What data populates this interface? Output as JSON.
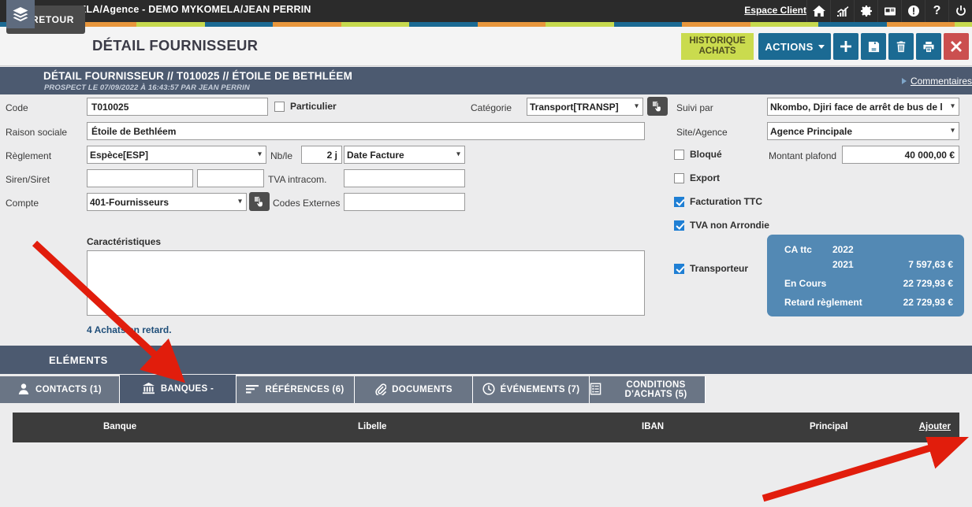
{
  "topbar": {
    "title": "DEMO MYKOMELA/Agence - DEMO MYKOMELA/JEAN PERRIN",
    "espace_client": "Espace Client",
    "icons": [
      "home-icon",
      "chart-icon",
      "gear-icon",
      "card-icon",
      "alert-icon",
      "help-icon",
      "power-icon"
    ]
  },
  "stripe_colors": [
    "#1b6a93",
    "#e8963c",
    "#c6d94e"
  ],
  "action_header": {
    "back_label": "RETOUR",
    "page_title": "DÉTAIL FOURNISSEUR",
    "historique_line1": "HISTORIQUE",
    "historique_line2": "ACHATS",
    "actions_label": "ACTIONS",
    "add_label": "add-icon",
    "save_label": "save-icon",
    "delete_label": "trash-icon",
    "print_label": "print-icon",
    "close_label": "close-icon"
  },
  "record_header": {
    "title": "DÉTAIL FOURNISSEUR // T010025 // ÉTOILE DE BETHLÉEM",
    "subtitle": "PROSPECT LE 07/09/2022 À 16:43:57 PAR JEAN PERRIN",
    "comments_link": "Commentaires"
  },
  "form": {
    "code_label": "Code",
    "code_value": "T010025",
    "particulier_label": "Particulier",
    "particulier_checked": false,
    "categorie_label": "Catégorie",
    "categorie_value": "Transport[TRANSP]",
    "suivi_par_label": "Suivi par",
    "suivi_par_value": "Nkombo, Djiri face de arrêt de bus de l",
    "raison_sociale_label": "Raison sociale",
    "raison_sociale_value": "Étoile de Bethléem",
    "site_agence_label": "Site/Agence",
    "site_agence_value": "Agence Principale",
    "reglement_label": "Règlement",
    "reglement_value": "Espèce[ESP]",
    "nble_label": "Nb/le",
    "nble_value": "2 j",
    "date_facture_value": "Date Facture",
    "bloque_label": "Bloqué",
    "bloque_checked": false,
    "montant_plafond_label": "Montant plafond",
    "montant_plafond_value": "40 000,00 €",
    "siren_siret_label": "Siren/Siret",
    "siren_value": "",
    "siret_value": "",
    "tva_intracom_label": "TVA intracom.",
    "tva_intracom_value": "",
    "export_label": "Export",
    "export_checked": false,
    "compte_label": "Compte",
    "compte_value": "401-Fournisseurs",
    "codes_externes_label": "Codes Externes",
    "codes_externes_value": "",
    "facturation_ttc_label": "Facturation TTC",
    "facturation_ttc_checked": true,
    "tva_non_arrondie_label": "TVA non Arrondie",
    "tva_non_arrondie_checked": true,
    "transporteur_label": "Transporteur",
    "transporteur_checked": true,
    "caracteristiques_label": "Caractéristiques",
    "caracteristiques_value": "",
    "achats_retard": "4 Achats en retard."
  },
  "stats": {
    "ca_ttc_label": "CA ttc",
    "year_current": "2022",
    "year_current_value": "",
    "year_prev": "2021",
    "year_prev_value": "7 597,63 €",
    "en_cours_label": "En Cours",
    "en_cours_value": "22 729,93 €",
    "retard_label": "Retard règlement",
    "retard_value": "22 729,93 €",
    "bg_color": "#5389b4"
  },
  "elements": {
    "label": "ELÉMENTS",
    "tabs": [
      {
        "label": "CONTACTS (1)",
        "icon": "person-icon",
        "active": false,
        "two_line": false
      },
      {
        "label": "BANQUES -",
        "icon": "bank-icon",
        "active": true,
        "two_line": false
      },
      {
        "label": "RÉFÉRENCES (6)",
        "icon": "list-icon",
        "active": false,
        "two_line": false
      },
      {
        "label": "DOCUMENTS",
        "icon": "paperclip-icon",
        "active": false,
        "two_line": false
      },
      {
        "label": "ÉVÉNEMENTS (7)",
        "icon": "clock-icon",
        "active": false,
        "two_line": false
      },
      {
        "label": "CONDITIONS D'ACHATS (5)",
        "icon": "document-icon",
        "active": false,
        "two_line": true
      }
    ]
  },
  "grid": {
    "columns": [
      "Banque",
      "Libelle",
      "IBAN",
      "Principal"
    ],
    "add_link": "Ajouter",
    "rows": []
  }
}
